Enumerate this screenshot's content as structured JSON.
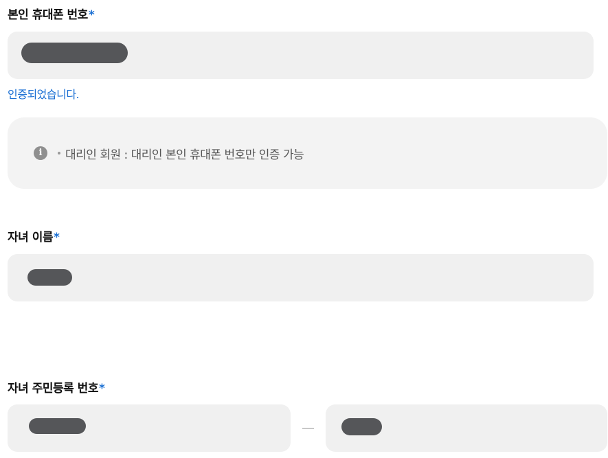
{
  "phone_section": {
    "label": "본인 휴대폰 번호",
    "required_mark": "*",
    "verified_message": "인증되었습니다."
  },
  "notice": {
    "icon": "info-icon",
    "icon_glyph": "i",
    "text": "대리인 회원 : 대리인 본인 휴대폰 번호만 인증 가능"
  },
  "child_name_section": {
    "label": "자녀 이름",
    "required_mark": "*"
  },
  "child_rrn_section": {
    "label": "자녀 주민등록 번호",
    "required_mark": "*"
  },
  "colors": {
    "accent": "#1a6fd3",
    "field_bg": "#f0f0f0",
    "mask": "#555659",
    "notice_bg": "#f3f3f3"
  }
}
